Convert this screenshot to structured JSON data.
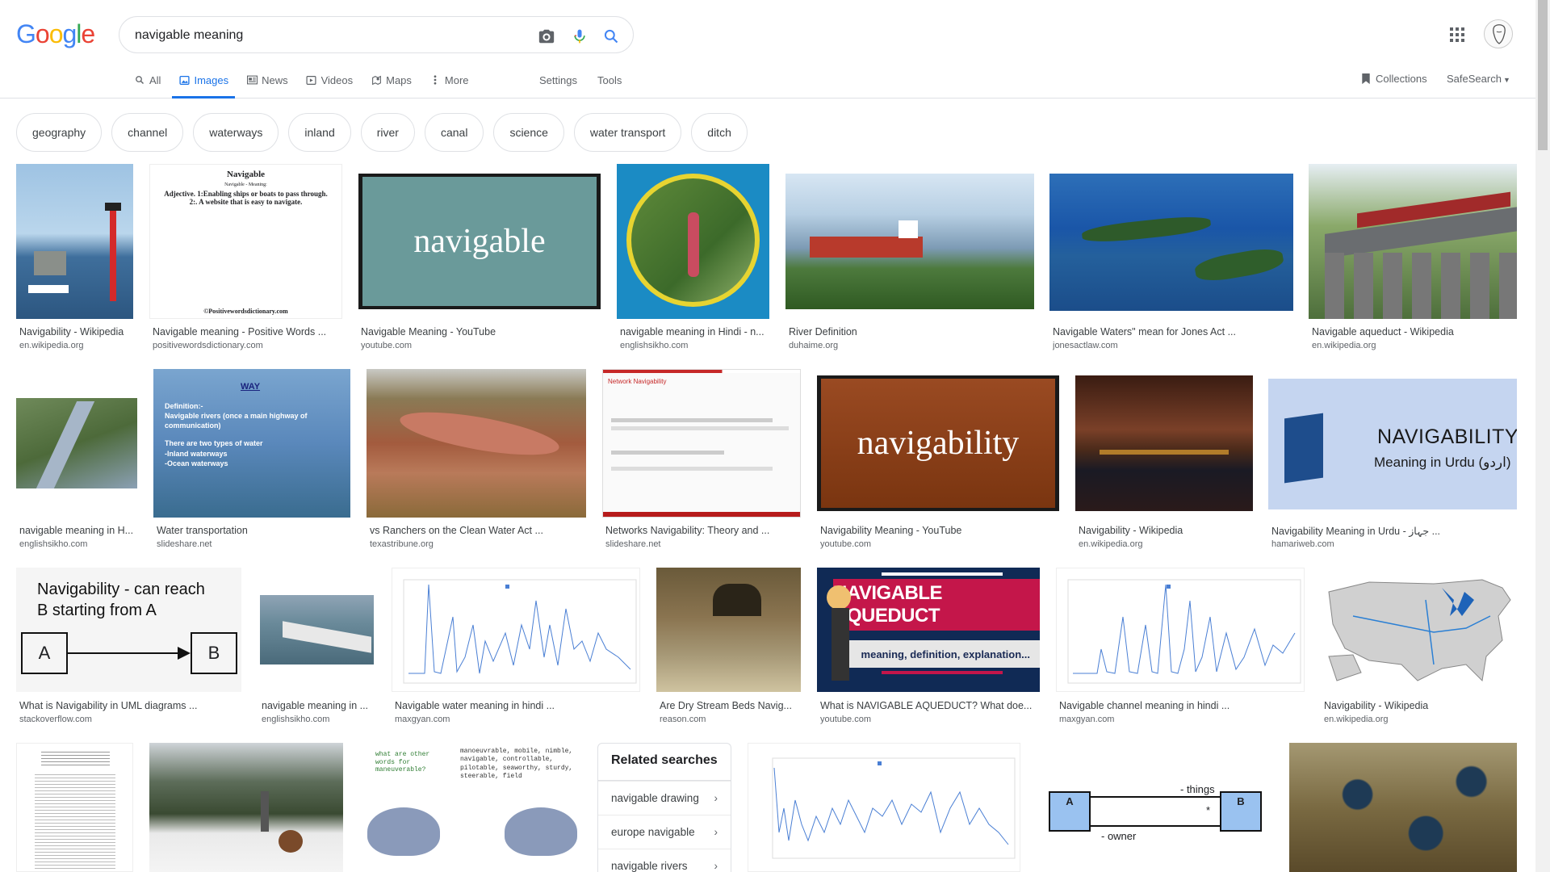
{
  "logo": [
    "G",
    "o",
    "o",
    "g",
    "l",
    "e"
  ],
  "logo_colors": [
    "#4285f4",
    "#ea4335",
    "#fbbc05",
    "#4285f4",
    "#34a853",
    "#ea4335"
  ],
  "search": {
    "query": "navigable meaning",
    "icons": [
      "camera-icon",
      "microphone-icon",
      "search-icon"
    ]
  },
  "tabs": [
    {
      "label": "All",
      "icon": "search-icon",
      "active": false
    },
    {
      "label": "Images",
      "icon": "image-icon",
      "active": true
    },
    {
      "label": "News",
      "icon": "news-icon",
      "active": false
    },
    {
      "label": "Videos",
      "icon": "video-icon",
      "active": false
    },
    {
      "label": "Maps",
      "icon": "map-icon",
      "active": false
    },
    {
      "label": "More",
      "icon": "more-dots-icon",
      "active": false
    }
  ],
  "settings_label": "Settings",
  "tools_label": "Tools",
  "collections_label": "Collections",
  "safesearch_label": "SafeSearch",
  "chips": [
    "geography",
    "channel",
    "waterways",
    "inland",
    "river",
    "canal",
    "science",
    "water transport",
    "ditch"
  ],
  "results": [
    {
      "caption": "Navigability - Wikipedia",
      "source": "en.wikipedia.org"
    },
    {
      "caption": "Navigable meaning - Positive Words ...",
      "source": "positivewordsdictionary.com"
    },
    {
      "caption": "Navigable Meaning - YouTube",
      "source": "youtube.com",
      "overlay": "navigable"
    },
    {
      "caption": "navigable meaning in Hindi - n...",
      "source": "englishsikho.com"
    },
    {
      "caption": "River Definition",
      "source": "duhaime.org"
    },
    {
      "caption": "Navigable Waters\" mean for Jones Act ...",
      "source": "jonesactlaw.com"
    },
    {
      "caption": "Navigable aqueduct - Wikipedia",
      "source": "en.wikipedia.org"
    },
    {
      "caption": "navigable meaning in H...",
      "source": "englishsikho.com"
    },
    {
      "caption": "Water transportation",
      "source": "slideshare.net"
    },
    {
      "caption": "vs Ranchers on the Clean Water Act ...",
      "source": "texastribune.org"
    },
    {
      "caption": "Networks Navigability: Theory and ...",
      "source": "slideshare.net"
    },
    {
      "caption": "Navigability Meaning - YouTube",
      "source": "youtube.com",
      "overlay": "navigability"
    },
    {
      "caption": "Navigability - Wikipedia",
      "source": "en.wikipedia.org"
    },
    {
      "caption": "Navigability Meaning in Urdu - جہاز ...",
      "source": "hamariweb.com",
      "overlay": "NAVIGABILITY",
      "overlay2": "Meaning in Urdu (اردو)"
    },
    {
      "caption": "What is Navigability in UML diagrams ...",
      "source": "stackoverflow.com",
      "overlay": "Navigability - can reach",
      "overlay2": "B starting from A"
    },
    {
      "caption": "navigable meaning in ...",
      "source": "englishsikho.com"
    },
    {
      "caption": "Navigable water meaning in hindi ...",
      "source": "maxgyan.com"
    },
    {
      "caption": "Are Dry Stream Beds Navig...",
      "source": "reason.com"
    },
    {
      "caption": "What is NAVIGABLE AQUEDUCT? What doe...",
      "source": "youtube.com",
      "overlay": "NAVIGABLE AQUEDUCT",
      "overlay2": "meaning, definition, explanation..."
    },
    {
      "caption": "Navigable channel meaning in hindi ...",
      "source": "maxgyan.com"
    },
    {
      "caption": "Navigability - Wikipedia",
      "source": "en.wikipedia.org"
    }
  ],
  "thumb_text": {
    "positive_title": "Navigable",
    "positive_sub": "Navigable - Meaning:",
    "positive_body": "Adjective. 1:Enabling ships or boats to pass through. 2:. A website that is easy to navigate.",
    "positive_footer": "©Positivewordsdictionary.com",
    "slide_way": "WAY",
    "slide_body": [
      "Definition:-",
      "Navigable rivers (once a main highway of communication)",
      "There are two types of water",
      "-Inland waterways",
      "-Ocean waterways"
    ],
    "network_title": "Network Navigability",
    "uml_a": "A",
    "uml_b": "B",
    "uml_things": "- things",
    "uml_star": "*",
    "uml_owner": "- owner",
    "pigeon_q": "what are other words for maneuverable?",
    "pigeon_a": "manoeuvrable, mobile, nimble, navigable, controllable, pilotable, seaworthy, sturdy, steerable, field"
  },
  "related": {
    "title": "Related searches",
    "items": [
      "navigable drawing",
      "europe navigable",
      "navigable rivers"
    ]
  }
}
